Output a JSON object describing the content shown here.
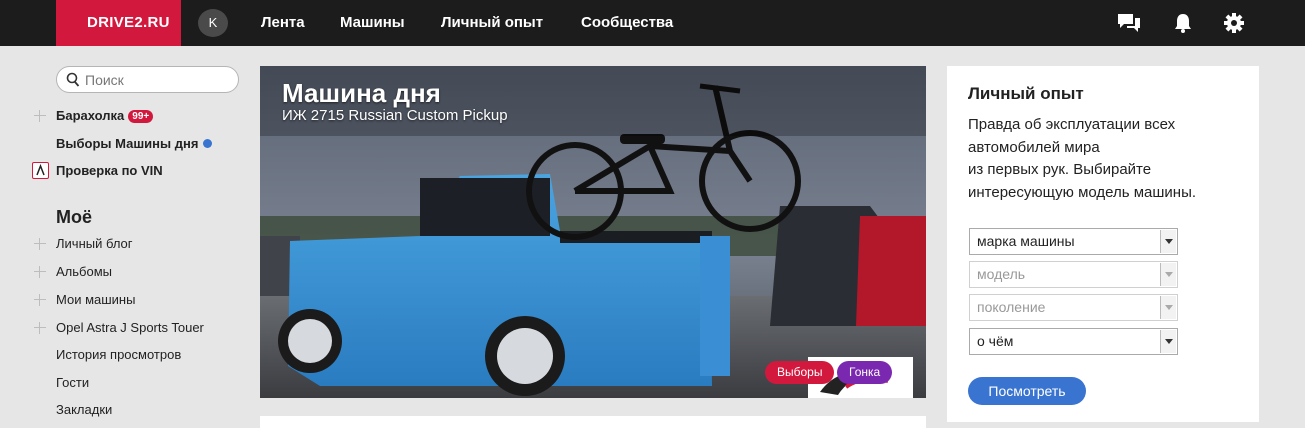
{
  "header": {
    "logo": "DRIVE2.RU",
    "avatar_letter": "K",
    "nav": [
      "Лента",
      "Машины",
      "Личный опыт",
      "Сообщества"
    ],
    "icons": [
      "messages-icon",
      "bell-icon",
      "gear-icon"
    ]
  },
  "sidebar": {
    "search_placeholder": "Поиск",
    "top_items": [
      {
        "label": "Барахолка",
        "badge": "99+"
      },
      {
        "label": "Выборы Машины дня"
      },
      {
        "label": "Проверка по VIN"
      }
    ],
    "section_title": "Моё",
    "my_items": [
      "Личный блог",
      "Альбомы",
      "Мои машины",
      "Opel Astra J Sports Touer",
      "История просмотров",
      "Гости",
      "Закладки"
    ]
  },
  "hero": {
    "title": "Машина дня",
    "subtitle": "ИЖ 2715 Russian Custom Pickup",
    "tags": [
      "Выборы",
      "Гонка"
    ]
  },
  "panel": {
    "title": "Личный опыт",
    "text_lines": [
      "Правда об эксплуатации всех",
      "автомобилей мира",
      "из первых рук. Выбирайте",
      "интересующую модель машины."
    ],
    "selects": [
      {
        "value": "марка машины",
        "disabled": false
      },
      {
        "value": "модель",
        "disabled": true
      },
      {
        "value": "поколение",
        "disabled": true
      },
      {
        "value": "о чём",
        "disabled": false
      }
    ],
    "button": "Посмотреть"
  },
  "colors": {
    "brand": "#d3183e",
    "accent": "#3a74d1",
    "topbar": "#1c1c1c",
    "tag_purple": "#7a28b0"
  }
}
